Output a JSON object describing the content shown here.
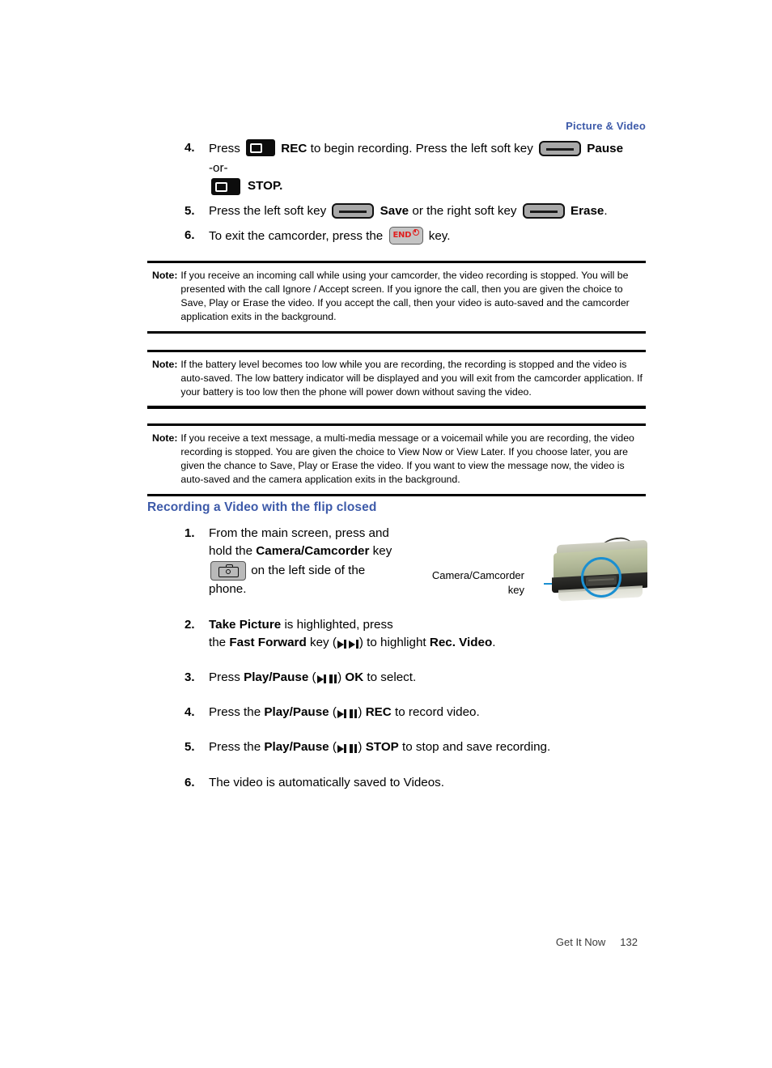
{
  "running_header": "Picture & Video",
  "top_steps": [
    {
      "num": "4.",
      "pre": "Press",
      "rec_label": "REC",
      "mid": "to begin recording. Press the left soft key",
      "pause_label": "Pause",
      "or_text": "-or-",
      "stop_label": "STOP."
    },
    {
      "num": "5.",
      "pre": "Press the left soft key",
      "save_label": "Save",
      "mid": "or the right soft key",
      "erase_label": "Erase",
      "end_period": "."
    },
    {
      "num": "6.",
      "pre": "To exit the camcorder, press the",
      "post": "key."
    }
  ],
  "notes": [
    {
      "label": "Note:",
      "text": "If you receive an incoming call while using your camcorder, the video recording is stopped. You will be presented with the call Ignore / Accept screen. If you ignore the call, then you are given the choice to Save, Play or Erase the video. If you accept the call, then your video is auto-saved and the camcorder application exits in the background."
    },
    {
      "label": "Note:",
      "text": "If the battery level becomes too low while you are recording, the recording is stopped and the video is auto-saved. The low battery indicator will be displayed and you will exit from the camcorder application. If your battery is too low then the phone will power down without saving the video."
    },
    {
      "label": "Note:",
      "text": "If you receive a text message, a multi-media message or a voicemail while you are recording, the video recording is stopped. You are given the choice to View Now or View Later. If you choose later, you are given the chance to Save, Play or Erase the video. If you want to view the message now, the video is auto-saved and the camera application exits in the background."
    }
  ],
  "section_heading": "Recording a Video with the flip closed",
  "lower_steps": [
    {
      "num": "1.",
      "part_a": "From the main screen, press and",
      "part_b_pre": "hold the",
      "part_b_bold": "Camera/Camcorder",
      "part_b_post": "key",
      "part_c": "on the left side of the",
      "part_d": "phone."
    },
    {
      "num": "2.",
      "bold_a": "Take Picture",
      "text_a": "is highlighted, press",
      "text_b_pre": "the",
      "bold_b": "Fast Forward",
      "text_b_mid": "key (",
      "text_b_post": ") to highlight",
      "bold_c": "Rec. Video",
      "text_b_end": "."
    },
    {
      "num": "3.",
      "pre": "Press",
      "bold_a": "Play/Pause",
      "paren_open": "(",
      "paren_close": ")",
      "bold_b": "OK",
      "post": "to select."
    },
    {
      "num": "4.",
      "pre": "Press the",
      "bold_a": "Play/Pause",
      "paren_open": "(",
      "paren_close": ")",
      "bold_b": "REC",
      "post": "to record video."
    },
    {
      "num": "5.",
      "pre": "Press the",
      "bold_a": "Play/Pause",
      "paren_open": "(",
      "paren_close": ")",
      "bold_b": "STOP",
      "post": "to stop and save recording."
    },
    {
      "num": "6.",
      "pre": "The video is automatically saved to Videos."
    }
  ],
  "figure": {
    "callout_line1": "Camera/Camcorder",
    "callout_line2": "key"
  },
  "footer": {
    "section": "Get It Now",
    "page": "132"
  },
  "colors": {
    "heading_blue": "#3d5aa9",
    "callout_blue": "#1a8fd1",
    "end_key_red": "#e02020"
  }
}
